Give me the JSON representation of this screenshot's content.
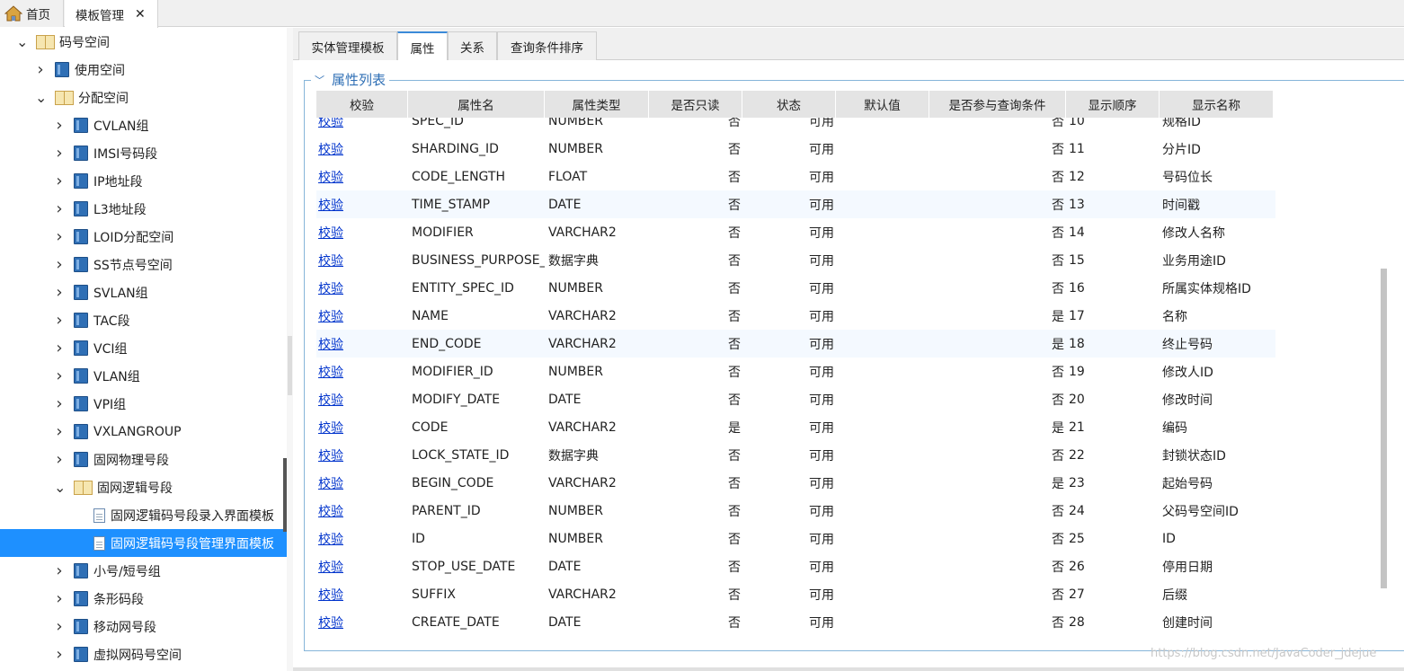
{
  "top_tabs": {
    "home_label": "首页",
    "template_label": "模板管理",
    "close_glyph": "✕"
  },
  "tree": [
    {
      "label": "码号空间",
      "level": 0,
      "expanded": true,
      "icon": "book-open-icon"
    },
    {
      "label": "使用空间",
      "level": 1,
      "expanded": false,
      "icon": "book-icon"
    },
    {
      "label": "分配空间",
      "level": 1,
      "expanded": true,
      "icon": "book-open-icon"
    },
    {
      "label": "CVLAN组",
      "level": 2,
      "expanded": false,
      "icon": "book-icon"
    },
    {
      "label": "IMSI号码段",
      "level": 2,
      "expanded": false,
      "icon": "book-icon"
    },
    {
      "label": "IP地址段",
      "level": 2,
      "expanded": false,
      "icon": "book-icon"
    },
    {
      "label": "L3地址段",
      "level": 2,
      "expanded": false,
      "icon": "book-icon"
    },
    {
      "label": "LOID分配空间",
      "level": 2,
      "expanded": false,
      "icon": "book-icon"
    },
    {
      "label": "SS节点号空间",
      "level": 2,
      "expanded": false,
      "icon": "book-icon"
    },
    {
      "label": "SVLAN组",
      "level": 2,
      "expanded": false,
      "icon": "book-icon"
    },
    {
      "label": "TAC段",
      "level": 2,
      "expanded": false,
      "icon": "book-icon"
    },
    {
      "label": "VCI组",
      "level": 2,
      "expanded": false,
      "icon": "book-icon"
    },
    {
      "label": "VLAN组",
      "level": 2,
      "expanded": false,
      "icon": "book-icon"
    },
    {
      "label": "VPI组",
      "level": 2,
      "expanded": false,
      "icon": "book-icon"
    },
    {
      "label": "VXLANGROUP",
      "level": 2,
      "expanded": false,
      "icon": "book-icon"
    },
    {
      "label": "固网物理号段",
      "level": 2,
      "expanded": false,
      "icon": "book-icon"
    },
    {
      "label": "固网逻辑号段",
      "level": 2,
      "expanded": true,
      "icon": "book-open-icon"
    },
    {
      "label": "固网逻辑码号段录入界面模板",
      "level": 3,
      "leaf": true,
      "icon": "page-icon"
    },
    {
      "label": "固网逻辑码号段管理界面模板",
      "level": 3,
      "leaf": true,
      "icon": "page-icon",
      "selected": true
    },
    {
      "label": "小号/短号组",
      "level": 2,
      "expanded": false,
      "icon": "book-icon"
    },
    {
      "label": "条形码段",
      "level": 2,
      "expanded": false,
      "icon": "book-icon"
    },
    {
      "label": "移动网号段",
      "level": 2,
      "expanded": false,
      "icon": "book-icon"
    },
    {
      "label": "虚拟网码号空间",
      "level": 2,
      "expanded": false,
      "icon": "book-icon"
    }
  ],
  "sub_tabs": [
    {
      "label": "实体管理模板",
      "active": false
    },
    {
      "label": "属性",
      "active": true
    },
    {
      "label": "关系",
      "active": false
    },
    {
      "label": "查询条件排序",
      "active": false
    }
  ],
  "section": {
    "title": "属性列表",
    "collapse_icon": "chevron-down-icon"
  },
  "grid": {
    "columns": [
      "校验",
      "属性名",
      "属性类型",
      "是否只读",
      "状态",
      "默认值",
      "是否参与查询条件",
      "显示顺序",
      "显示名称"
    ],
    "rows": [
      {
        "check": "校验",
        "name": "SPEC_ID",
        "type": "NUMBER",
        "readonly": "否",
        "status": "可用",
        "default": "",
        "query": "否",
        "order": "10",
        "display": "规格ID"
      },
      {
        "check": "校验",
        "name": "SHARDING_ID",
        "type": "NUMBER",
        "readonly": "否",
        "status": "可用",
        "default": "",
        "query": "否",
        "order": "11",
        "display": "分片ID"
      },
      {
        "check": "校验",
        "name": "CODE_LENGTH",
        "type": "FLOAT",
        "readonly": "否",
        "status": "可用",
        "default": "",
        "query": "否",
        "order": "12",
        "display": "号码位长"
      },
      {
        "check": "校验",
        "name": "TIME_STAMP",
        "type": "DATE",
        "readonly": "否",
        "status": "可用",
        "default": "",
        "query": "否",
        "order": "13",
        "display": "时间戳",
        "highlight": true
      },
      {
        "check": "校验",
        "name": "MODIFIER",
        "type": "VARCHAR2",
        "readonly": "否",
        "status": "可用",
        "default": "",
        "query": "否",
        "order": "14",
        "display": "修改人名称"
      },
      {
        "check": "校验",
        "name": "BUSINESS_PURPOSE_I",
        "type": "数据字典",
        "readonly": "否",
        "status": "可用",
        "default": "",
        "query": "否",
        "order": "15",
        "display": "业务用途ID"
      },
      {
        "check": "校验",
        "name": "ENTITY_SPEC_ID",
        "type": "NUMBER",
        "readonly": "否",
        "status": "可用",
        "default": "",
        "query": "否",
        "order": "16",
        "display": "所属实体规格ID"
      },
      {
        "check": "校验",
        "name": "NAME",
        "type": "VARCHAR2",
        "readonly": "否",
        "status": "可用",
        "default": "",
        "query": "是",
        "order": "17",
        "display": "名称"
      },
      {
        "check": "校验",
        "name": "END_CODE",
        "type": "VARCHAR2",
        "readonly": "否",
        "status": "可用",
        "default": "",
        "query": "是",
        "order": "18",
        "display": "终止号码",
        "highlight": true
      },
      {
        "check": "校验",
        "name": "MODIFIER_ID",
        "type": "NUMBER",
        "readonly": "否",
        "status": "可用",
        "default": "",
        "query": "否",
        "order": "19",
        "display": "修改人ID"
      },
      {
        "check": "校验",
        "name": "MODIFY_DATE",
        "type": "DATE",
        "readonly": "否",
        "status": "可用",
        "default": "",
        "query": "否",
        "order": "20",
        "display": "修改时间"
      },
      {
        "check": "校验",
        "name": "CODE",
        "type": "VARCHAR2",
        "readonly": "是",
        "status": "可用",
        "default": "",
        "query": "是",
        "order": "21",
        "display": "编码"
      },
      {
        "check": "校验",
        "name": "LOCK_STATE_ID",
        "type": "数据字典",
        "readonly": "否",
        "status": "可用",
        "default": "",
        "query": "否",
        "order": "22",
        "display": "封锁状态ID"
      },
      {
        "check": "校验",
        "name": "BEGIN_CODE",
        "type": "VARCHAR2",
        "readonly": "否",
        "status": "可用",
        "default": "",
        "query": "是",
        "order": "23",
        "display": "起始号码"
      },
      {
        "check": "校验",
        "name": "PARENT_ID",
        "type": "NUMBER",
        "readonly": "否",
        "status": "可用",
        "default": "",
        "query": "否",
        "order": "24",
        "display": "父码号空间ID"
      },
      {
        "check": "校验",
        "name": "ID",
        "type": "NUMBER",
        "readonly": "否",
        "status": "可用",
        "default": "",
        "query": "否",
        "order": "25",
        "display": "ID"
      },
      {
        "check": "校验",
        "name": "STOP_USE_DATE",
        "type": "DATE",
        "readonly": "否",
        "status": "可用",
        "default": "",
        "query": "否",
        "order": "26",
        "display": "停用日期"
      },
      {
        "check": "校验",
        "name": "SUFFIX",
        "type": "VARCHAR2",
        "readonly": "否",
        "status": "可用",
        "default": "",
        "query": "否",
        "order": "27",
        "display": "后缀"
      },
      {
        "check": "校验",
        "name": "CREATE_DATE",
        "type": "DATE",
        "readonly": "否",
        "status": "可用",
        "default": "",
        "query": "否",
        "order": "28",
        "display": "创建时间"
      }
    ]
  },
  "watermark": "https://blog.csdn.net/JavaCoder_jdejue",
  "colors": {
    "accent": "#1e90ff",
    "link": "#0033cc",
    "legend": "#2f6fb5"
  }
}
